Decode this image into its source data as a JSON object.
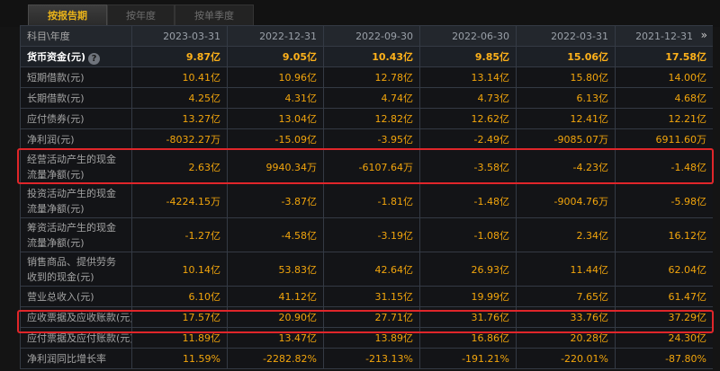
{
  "tabs": [
    {
      "label": "按报告期"
    },
    {
      "label": "按年度"
    },
    {
      "label": "按单季度"
    }
  ],
  "table": {
    "header_label": "科目\\年度",
    "dates": [
      "2023-03-31",
      "2022-12-31",
      "2022-09-30",
      "2022-06-30",
      "2022-03-31",
      "2021-12-31"
    ],
    "more_glyph": "»",
    "rows": [
      {
        "label": "货币资金(元)",
        "values": [
          "9.87亿",
          "9.05亿",
          "10.43亿",
          "9.85亿",
          "15.06亿",
          "17.58亿"
        ]
      },
      {
        "label": "短期借款(元)",
        "values": [
          "10.41亿",
          "10.96亿",
          "12.78亿",
          "13.14亿",
          "15.80亿",
          "14.00亿"
        ]
      },
      {
        "label": "长期借款(元)",
        "values": [
          "4.25亿",
          "4.31亿",
          "4.74亿",
          "4.73亿",
          "6.13亿",
          "4.68亿"
        ]
      },
      {
        "label": "应付债券(元)",
        "values": [
          "13.27亿",
          "13.04亿",
          "12.82亿",
          "12.62亿",
          "12.41亿",
          "12.21亿"
        ]
      },
      {
        "label": "净利润(元)",
        "values": [
          "-8032.27万",
          "-15.09亿",
          "-3.95亿",
          "-2.49亿",
          "-9085.07万",
          "6911.60万"
        ]
      },
      {
        "label": "经营活动产生的现金流量净额(元)",
        "values": [
          "2.63亿",
          "9940.34万",
          "-6107.64万",
          "-3.58亿",
          "-4.23亿",
          "-1.48亿"
        ]
      },
      {
        "label": "投资活动产生的现金流量净额(元)",
        "values": [
          "-4224.15万",
          "-3.87亿",
          "-1.81亿",
          "-1.48亿",
          "-9004.76万",
          "-5.98亿"
        ]
      },
      {
        "label": "筹资活动产生的现金流量净额(元)",
        "values": [
          "-1.27亿",
          "-4.58亿",
          "-3.19亿",
          "-1.08亿",
          "2.34亿",
          "16.12亿"
        ]
      },
      {
        "label": "销售商品、提供劳务收到的现金(元)",
        "values": [
          "10.14亿",
          "53.83亿",
          "42.64亿",
          "26.93亿",
          "11.44亿",
          "62.04亿"
        ]
      },
      {
        "label": "营业总收入(元)",
        "values": [
          "6.10亿",
          "41.12亿",
          "31.15亿",
          "19.99亿",
          "7.65亿",
          "61.47亿"
        ]
      },
      {
        "label": "应收票据及应收账款(元)",
        "values": [
          "17.57亿",
          "20.90亿",
          "27.71亿",
          "31.76亿",
          "33.76亿",
          "37.29亿"
        ]
      },
      {
        "label": "应付票据及应付账款(元)",
        "values": [
          "11.89亿",
          "13.47亿",
          "13.89亿",
          "16.86亿",
          "20.28亿",
          "24.30亿"
        ]
      },
      {
        "label": "净利润同比增长率",
        "values": [
          "11.59%",
          "-2282.82%",
          "-213.13%",
          "-191.21%",
          "-220.01%",
          "-87.80%"
        ]
      }
    ]
  },
  "colors": {
    "accent": "#f2a50c",
    "highlight": "#e0262a",
    "background": "#141414"
  }
}
